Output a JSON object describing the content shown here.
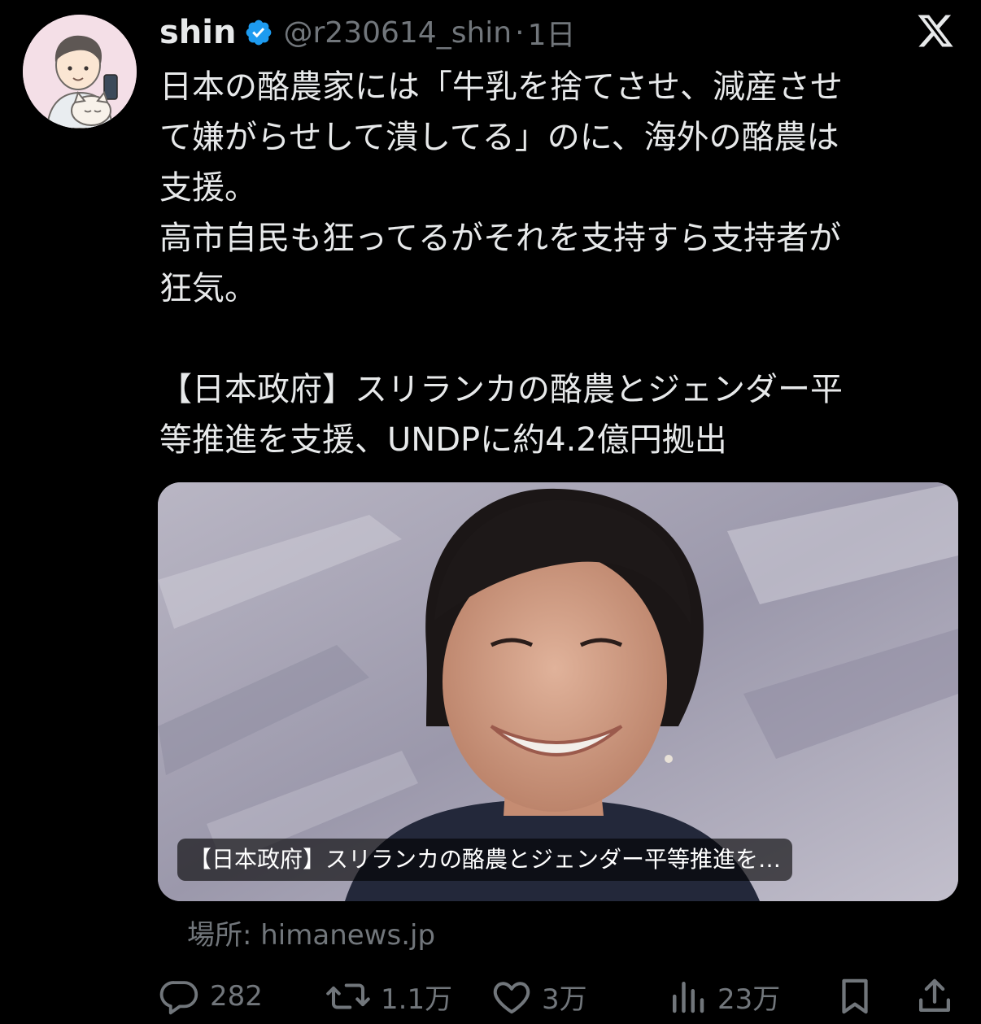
{
  "tweet": {
    "author_name": "shin",
    "handle": "@r230614_shin",
    "separator": "·",
    "time": "1日",
    "text_lines": [
      "日本の酪農家には「牛乳を捨てさせ、減産させ",
      "て嫌がらせして潰してる」のに、海外の酪農は",
      "支援。",
      "高市自民も狂ってるがそれを支持すら支持者が",
      "狂気。",
      "",
      "【日本政府】スリランカの酪農とジェンダー平",
      "等推進を支援、UNDPに約4.2億円拠出"
    ]
  },
  "card": {
    "caption": "【日本政府】スリランカの酪農とジェンダー平等推進を…",
    "source": "場所: himanews.jp"
  },
  "actions": {
    "replies": "282",
    "reposts": "1.1万",
    "likes": "3万",
    "views": "23万"
  },
  "icons": {
    "verified": "verified-badge-icon",
    "brand": "x-logo-icon",
    "reply": "reply-icon",
    "repost": "repost-icon",
    "like": "like-icon",
    "views": "views-icon",
    "bookmark": "bookmark-icon",
    "share": "share-icon"
  },
  "colors": {
    "background": "#000000",
    "text": "#e7e9ea",
    "muted": "#71767b",
    "verified": "#1d9bf0"
  }
}
